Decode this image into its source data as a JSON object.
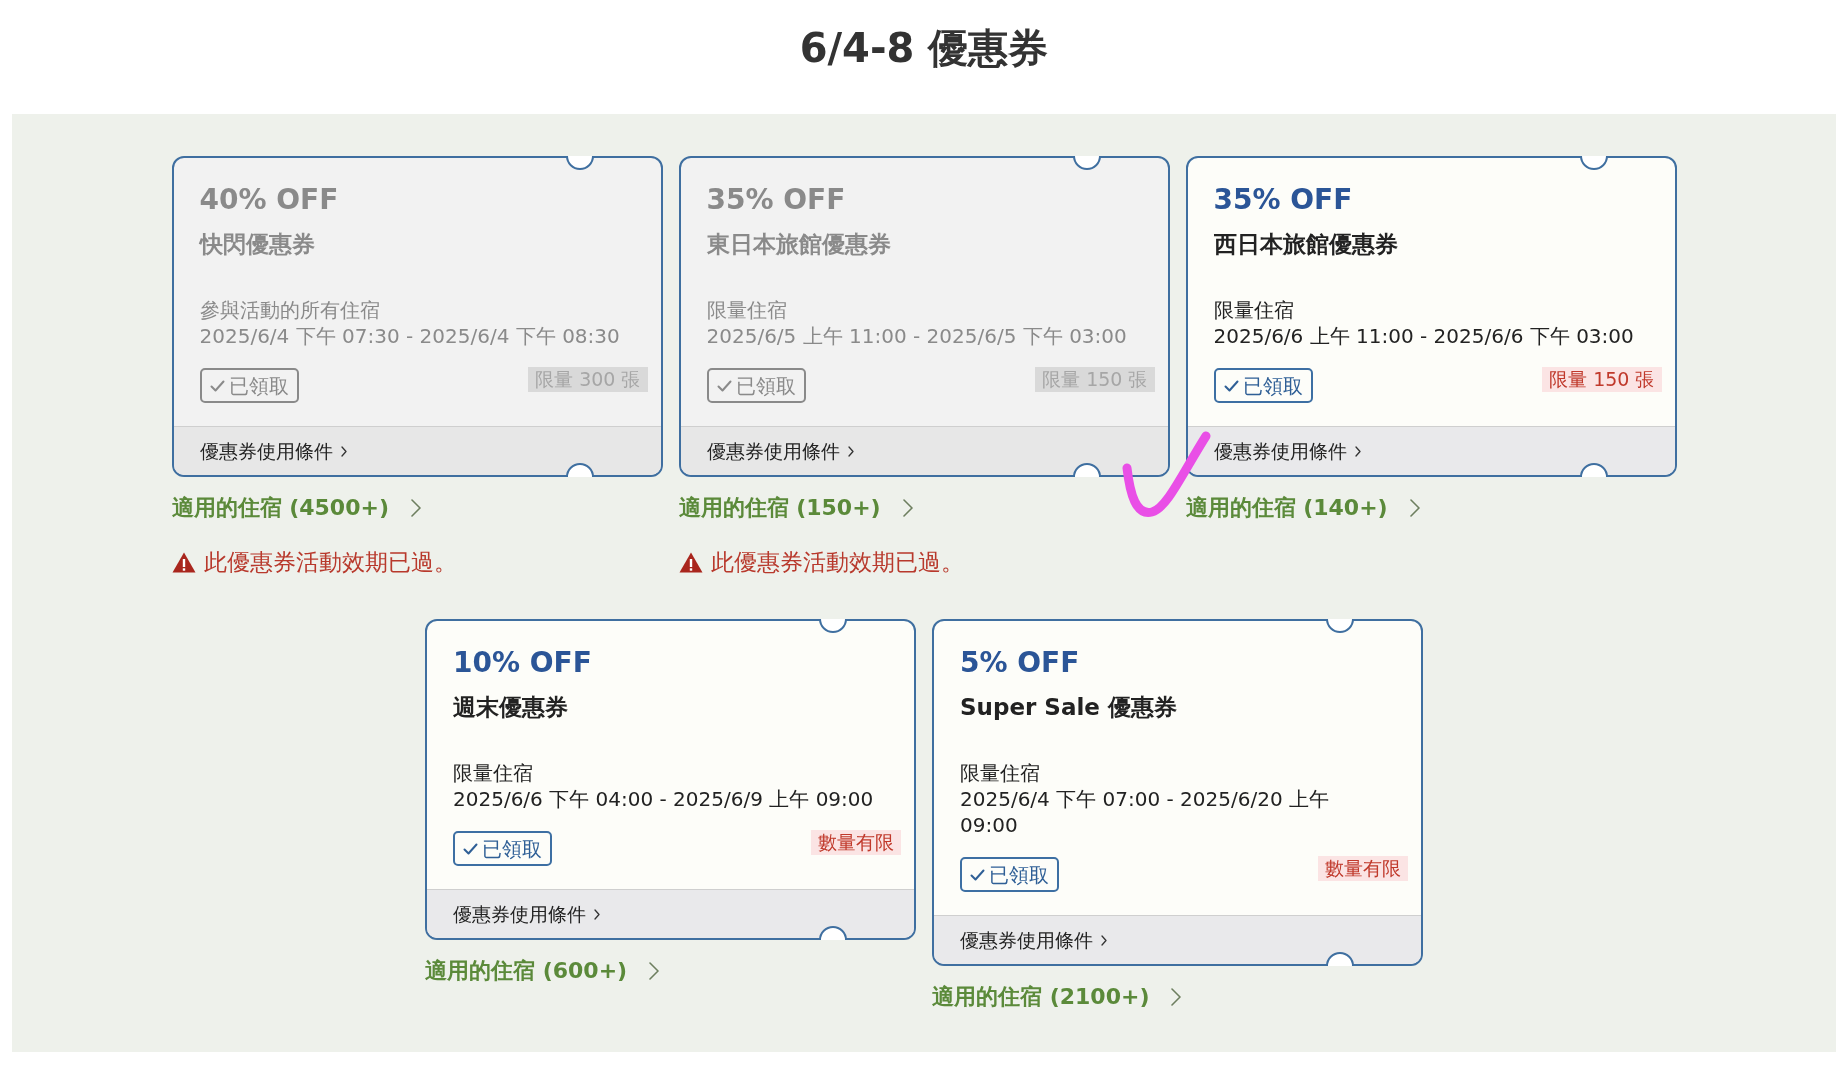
{
  "page": {
    "title": "6/4-8 優惠券"
  },
  "coupons": [
    {
      "discount": "40% OFF",
      "name": "快閃優惠券",
      "scope": "參與活動的所有住宿",
      "period": "2025/6/4 下午 07:30 - 2025/6/4 下午 08:30",
      "claim_button": "已領取",
      "quota": "限量 300 張",
      "terms_link": "優惠券使用條件",
      "expired": true,
      "hotels_link": "適用的住宿 (4500+)",
      "warning": "此優惠券活動效期已過。"
    },
    {
      "discount": "35% OFF",
      "name": "東日本旅館優惠券",
      "scope": "限量住宿",
      "period": "2025/6/5 上午 11:00 - 2025/6/5 下午 03:00",
      "claim_button": "已領取",
      "quota": "限量 150 張",
      "terms_link": "優惠券使用條件",
      "expired": true,
      "hotels_link": "適用的住宿 (150+)",
      "warning": "此優惠券活動效期已過。"
    },
    {
      "discount": "35% OFF",
      "name": "西日本旅館優惠券",
      "scope": "限量住宿",
      "period": "2025/6/6 上午 11:00 - 2025/6/6 下午 03:00",
      "claim_button": "已領取",
      "quota": "限量 150 張",
      "terms_link": "優惠券使用條件",
      "expired": false,
      "hotels_link": "適用的住宿 (140+)"
    },
    {
      "discount": "10% OFF",
      "name": "週末優惠券",
      "scope": "限量住宿",
      "period": "2025/6/6 下午 04:00 - 2025/6/9 上午 09:00",
      "claim_button": "已領取",
      "quota": "數量有限",
      "terms_link": "優惠券使用條件",
      "expired": false,
      "hotels_link": "適用的住宿 (600+)"
    },
    {
      "discount": "5% OFF",
      "name": "Super Sale 優惠券",
      "scope": "限量住宿",
      "period": "2025/6/4 下午 07:00 - 2025/6/20 上午 09:00",
      "claim_button": "已領取",
      "quota": "數量有限",
      "terms_link": "優惠券使用條件",
      "expired": false,
      "hotels_link": "適用的住宿 (2100+)"
    }
  ]
}
